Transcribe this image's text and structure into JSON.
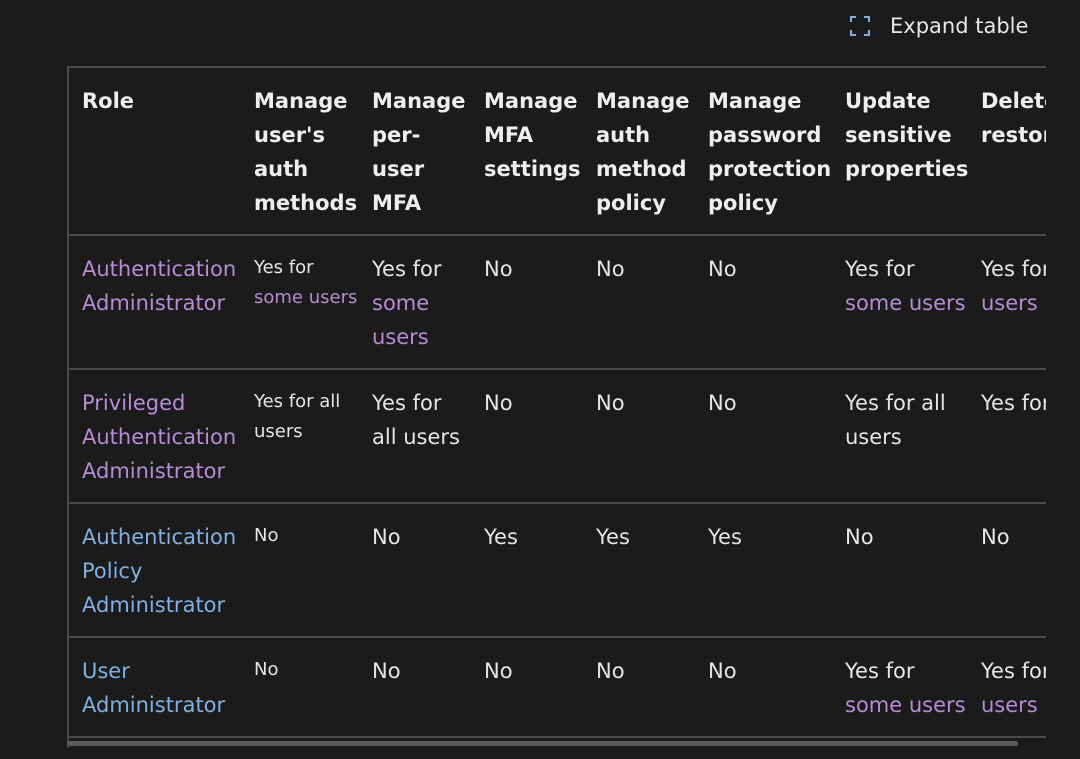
{
  "expand_label": "Expand table",
  "headers": [
    "Role",
    "Manage user's auth methods",
    "Manage per-user MFA",
    "Manage MFA settings",
    "Manage auth method policy",
    "Manage password protection policy",
    "Update sensitive properties",
    "Delete and restore users"
  ],
  "rows": [
    {
      "role": "Authentication Administrator",
      "role_color": "purple",
      "cells": [
        {
          "text": "Yes for",
          "link": "some users"
        },
        {
          "text": "Yes for",
          "link": "some users"
        },
        {
          "text": "No"
        },
        {
          "text": "No"
        },
        {
          "text": "No"
        },
        {
          "text": "Yes for",
          "link": "some users"
        },
        {
          "text": "Yes for",
          "link": "some users"
        }
      ]
    },
    {
      "role": "Privileged Authentication Administrator",
      "role_color": "purple",
      "cells": [
        {
          "text": "Yes for all users"
        },
        {
          "text": "Yes for all users"
        },
        {
          "text": "No"
        },
        {
          "text": "No"
        },
        {
          "text": "No"
        },
        {
          "text": "Yes for all users"
        },
        {
          "text": "Yes for all users"
        }
      ]
    },
    {
      "role": "Authentication Policy Administrator",
      "role_color": "blue",
      "cells": [
        {
          "text": "No"
        },
        {
          "text": "No"
        },
        {
          "text": "Yes"
        },
        {
          "text": "Yes"
        },
        {
          "text": "Yes"
        },
        {
          "text": "No"
        },
        {
          "text": "No"
        }
      ]
    },
    {
      "role": "User Administrator",
      "role_color": "blue",
      "cells": [
        {
          "text": "No"
        },
        {
          "text": "No"
        },
        {
          "text": "No"
        },
        {
          "text": "No"
        },
        {
          "text": "No"
        },
        {
          "text": "Yes for",
          "link": "some users"
        },
        {
          "text": "Yes for",
          "link": "some users"
        }
      ]
    }
  ],
  "colors": {
    "background": "#1b1b1c",
    "link_purple": "#b48ed4",
    "link_blue": "#7fb2e0",
    "border": "#4a4a4a"
  }
}
